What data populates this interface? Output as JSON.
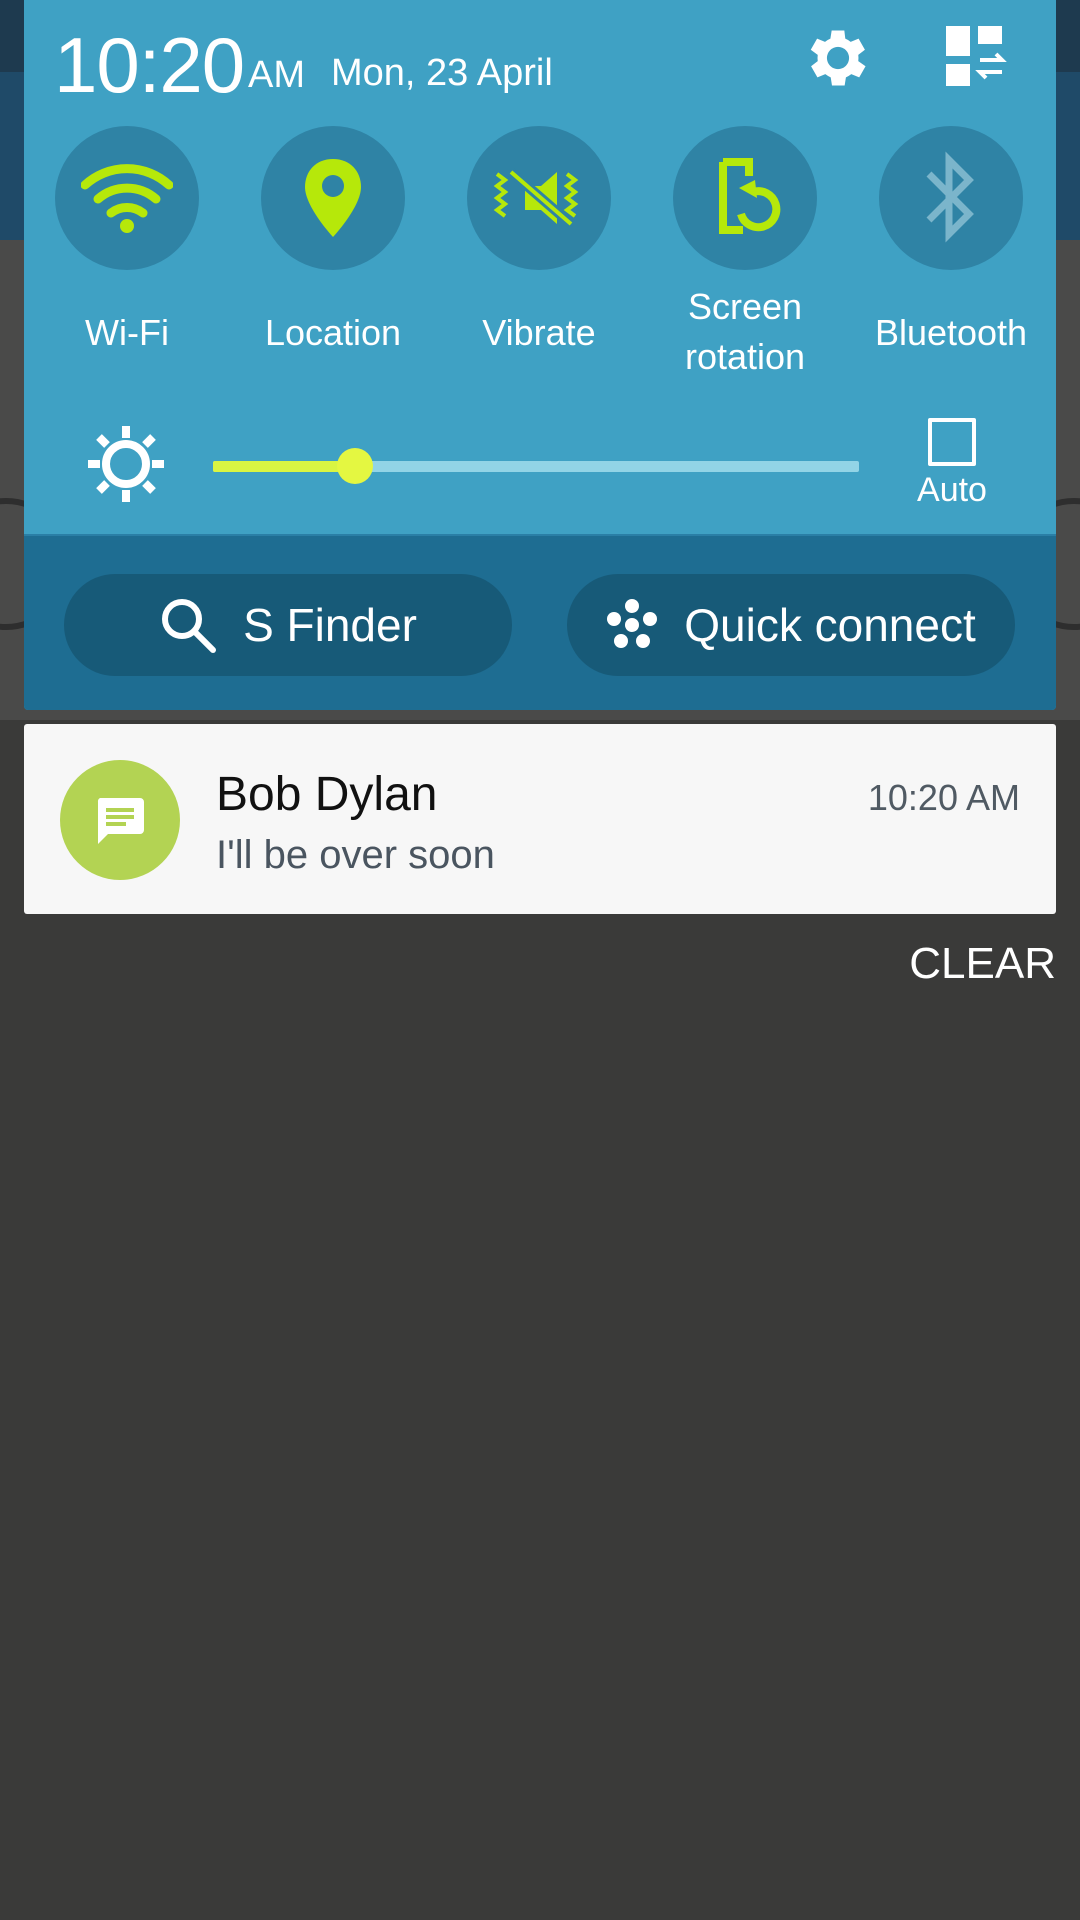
{
  "status": {
    "time": "10:20",
    "ampm": "AM",
    "date": "Mon, 23 April"
  },
  "header_icons": {
    "settings": "gear-icon",
    "edit": "edit-quick-settings-icon"
  },
  "quick_settings": [
    {
      "label": "Wi-Fi",
      "label2": "",
      "icon": "wifi-icon",
      "active": true
    },
    {
      "label": "Location",
      "label2": "",
      "icon": "location-pin-icon",
      "active": true
    },
    {
      "label": "Vibrate",
      "label2": "",
      "icon": "vibrate-icon",
      "active": true
    },
    {
      "label": "Screen",
      "label2": "rotation",
      "icon": "screen-rotation-icon",
      "active": true
    },
    {
      "label": "Bluetooth",
      "label2": "",
      "icon": "bluetooth-icon",
      "active": false
    }
  ],
  "brightness": {
    "level_fraction": 0.22,
    "auto_label": "Auto",
    "auto_checked": false
  },
  "actions": {
    "s_finder": "S Finder",
    "quick_connect": "Quick connect"
  },
  "notification": {
    "title": "Bob Dylan",
    "text": "I'll be over soon",
    "time": "10:20 AM",
    "icon": "message-icon"
  },
  "clear_label": "CLEAR",
  "colors": {
    "panel": "#3fa1c4",
    "panel_bottom": "#1e6d92",
    "accent": "#b6e80a",
    "inactive_icon": "#7bb5cb",
    "notification_avatar": "#b3d353"
  }
}
